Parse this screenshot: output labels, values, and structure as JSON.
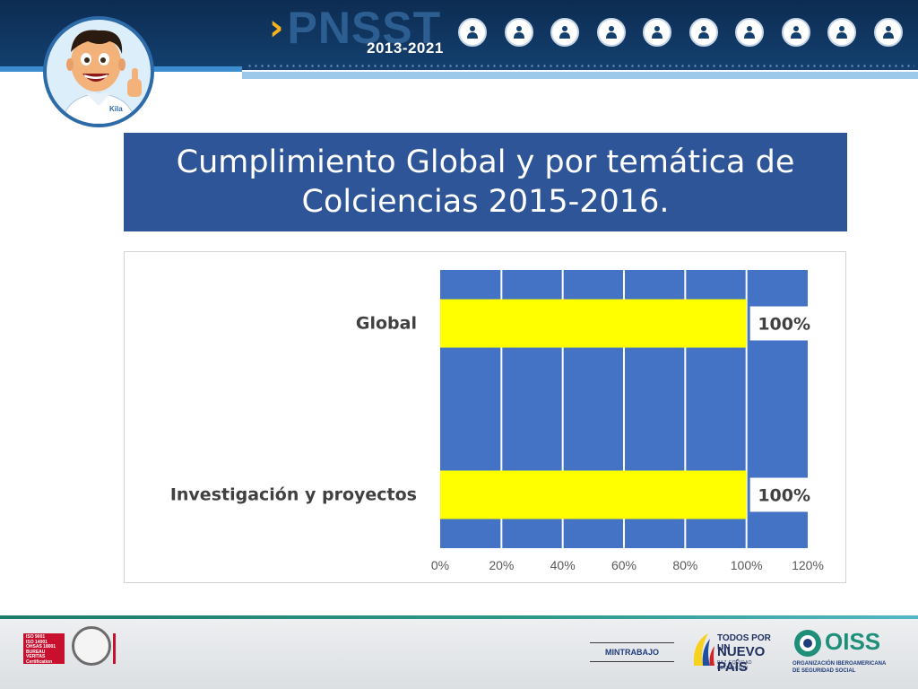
{
  "header": {
    "brand": "PNSST",
    "years": "2013-2021",
    "icons": [
      "workers-group-icon",
      "mining-icon",
      "computer-worker-icon",
      "office-worker-icon",
      "cyclist-worker-icon",
      "construction-icon",
      "farmer-icon",
      "inspector-icon",
      "doctor-icon",
      "firefighter-icon"
    ]
  },
  "title": "Cumplimiento Global y por temática de\nColciencias 2015-2016.",
  "chart_data": {
    "type": "bar",
    "orientation": "horizontal",
    "categories": [
      "Global",
      "Investigación y proyectos"
    ],
    "values": [
      1.0,
      1.0
    ],
    "data_labels": [
      "100%",
      "100%"
    ],
    "x_ticks": [
      "0%",
      "20%",
      "40%",
      "60%",
      "80%",
      "100%",
      "120%"
    ],
    "xlim": [
      0,
      1.2
    ],
    "grid": true,
    "bar_color": "#ffff00",
    "plot_background": "#4472c4",
    "title": "",
    "xlabel": "",
    "ylabel": ""
  },
  "footer": {
    "bv_badge": "ISO 9001\nISO 14001\nOHSAS 18001\nBUREAU VERITAS\nCertification",
    "mintrabajo": "MINTRABAJO",
    "todos_line1": "TODOS POR UN",
    "todos_line2": "NUEVO PAÍS",
    "todos_line3": "PAZ  EQUIDAD  EDUCACIÓN",
    "oiss": "OISS",
    "oiss_sub": "ORGANIZACIÓN IBEROAMERICANA\nDE SEGURIDAD SOCIAL"
  },
  "colors": {
    "header": "#13406f",
    "title_box": "#2e5597",
    "accent": "#f6b21c"
  }
}
